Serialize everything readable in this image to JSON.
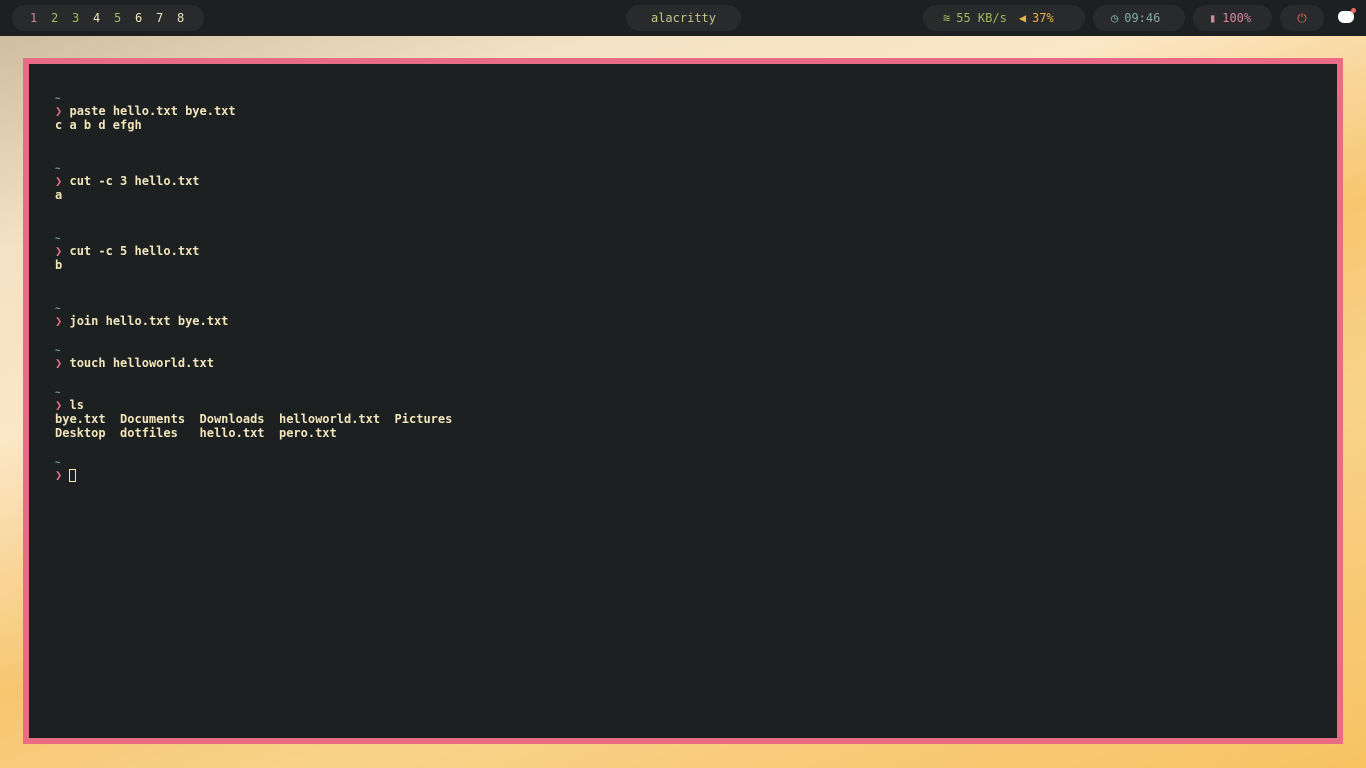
{
  "topbar": {
    "workspaces": [
      {
        "label": "1",
        "color": "#d3869b"
      },
      {
        "label": "2",
        "color": "#a9b665"
      },
      {
        "label": "3",
        "color": "#a9b665"
      },
      {
        "label": "4",
        "color": "#f2e5bc"
      },
      {
        "label": "5",
        "color": "#a9b665"
      },
      {
        "label": "6",
        "color": "#f2e5bc"
      },
      {
        "label": "7",
        "color": "#f2e5bc"
      },
      {
        "label": "8",
        "color": "#f2e5bc"
      }
    ],
    "window_title": "alacritty",
    "network": "55 KB/s",
    "volume": "37%",
    "clock": "09:46",
    "battery": "100%"
  },
  "terminal": {
    "prompt_dir": "~",
    "prompt_symbol": "❯",
    "lines": [
      {
        "t": "dir"
      },
      {
        "t": "cmd",
        "text": "paste hello.txt bye.txt"
      },
      {
        "t": "out",
        "text": "c a b d efgh"
      },
      {
        "t": "blank"
      },
      {
        "t": "blank"
      },
      {
        "t": "dir"
      },
      {
        "t": "cmd",
        "text": "cut -c 3 hello.txt"
      },
      {
        "t": "out",
        "text": "a"
      },
      {
        "t": "blank"
      },
      {
        "t": "blank"
      },
      {
        "t": "dir"
      },
      {
        "t": "cmd",
        "text": "cut -c 5 hello.txt"
      },
      {
        "t": "out",
        "text": "b"
      },
      {
        "t": "blank"
      },
      {
        "t": "blank"
      },
      {
        "t": "dir"
      },
      {
        "t": "cmd",
        "text": "join hello.txt bye.txt"
      },
      {
        "t": "blank"
      },
      {
        "t": "dir"
      },
      {
        "t": "cmd",
        "text": "touch helloworld.txt"
      },
      {
        "t": "blank"
      },
      {
        "t": "dir"
      },
      {
        "t": "cmd",
        "text": "ls"
      },
      {
        "t": "out",
        "text": "bye.txt  Documents  Downloads  helloworld.txt  Pictures"
      },
      {
        "t": "out",
        "text": "Desktop  dotfiles   hello.txt  pero.txt"
      },
      {
        "t": "blank"
      },
      {
        "t": "dir"
      },
      {
        "t": "cursor"
      }
    ]
  }
}
